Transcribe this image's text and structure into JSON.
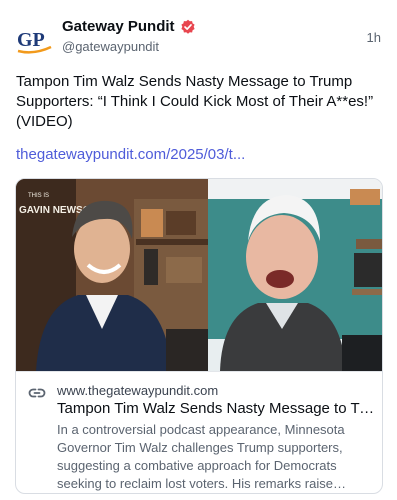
{
  "author": {
    "name": "Gateway Pundit",
    "handle": "@gatewaypundit",
    "avatar_text": "GP"
  },
  "post": {
    "time": "1h",
    "text": "Tampon Tim Walz Sends Nasty Message to Trump Supporters: “I Think I Could Kick Most of Their A**es!” (VIDEO)",
    "link_text": "thegatewaypundit.com/2025/03/t..."
  },
  "card": {
    "domain": "www.thegatewaypundit.com",
    "title": "Tampon Tim Walz Sends Nasty Message to Trump Supporters",
    "description": "In a controversial podcast appearance, Minnesota Governor Tim Walz challenges Trump supporters, suggesting a combative approach for Democrats seeking to reclaim lost voters. His remarks raise questions about the party's direction.",
    "thumb_sign_top": "THIS IS",
    "thumb_sign_bottom": "GAVIN NEWSOM"
  },
  "colors": {
    "accent_link": "#4f5cd9",
    "verified_badge": "#e8464f",
    "avatar_blue": "#1e3a78",
    "avatar_orange": "#f29a1c"
  },
  "icons": {
    "verified": "verified-badge-icon",
    "link": "link-icon"
  }
}
